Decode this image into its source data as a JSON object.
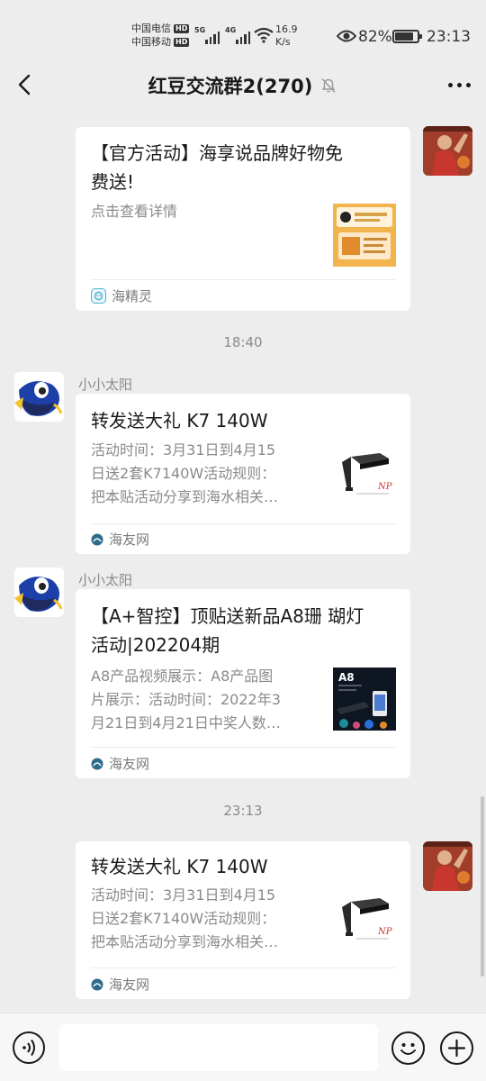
{
  "status_bar": {
    "carrier1": "中国电信",
    "carrier2": "中国移动",
    "hd_badge": "HD",
    "net1": "5G",
    "net2": "4G",
    "speed_value": "16.9",
    "speed_unit": "K/s",
    "battery_percent": "82%",
    "battery_level": 0.82,
    "time": "23:13"
  },
  "nav": {
    "title": "红豆交流群2(270)",
    "muted_icon": "bell-off-icon",
    "back_icon": "chevron-left-icon",
    "more_icon": "more-dots-icon"
  },
  "messages": [
    {
      "type": "link_card",
      "direction": "outgoing",
      "title_line1": "【官方活动】海享说品牌好物免",
      "title_line2": "费送!",
      "desc_line1": "点击查看详情",
      "source": "海精灵",
      "source_icon": "mini-program-icon"
    },
    {
      "type": "time",
      "text": "18:40"
    },
    {
      "type": "link_card",
      "direction": "incoming",
      "sender": "小小太阳",
      "title_line1": "转发送大礼 K7 140W",
      "desc_line1": "活动时间：3月31日到4月15",
      "desc_line2": "日送2套K7140W活动规则：",
      "desc_line3": "把本贴活动分享到海水相关…",
      "source": "海友网",
      "source_icon": "site-icon"
    },
    {
      "type": "link_card",
      "direction": "incoming",
      "sender": "小小太阳",
      "title_line1": "【A+智控】顶贴送新品A8珊 瑚灯",
      "title_line2": "活动|202204期",
      "desc_line1": "A8产品视频展示：A8产品图",
      "desc_line2": "片展示：活动时间：2022年3",
      "desc_line3": "月21日到4月21日中奖人数…",
      "thumb_label": "A8",
      "source": "海友网",
      "source_icon": "site-icon"
    },
    {
      "type": "time",
      "text": "23:13"
    },
    {
      "type": "link_card",
      "direction": "outgoing",
      "title_line1": "转发送大礼 K7 140W",
      "desc_line1": "活动时间：3月31日到4月15",
      "desc_line2": "日送2套K7140W活动规则：",
      "desc_line3": "把本贴活动分享到海水相关…",
      "source": "海友网",
      "source_icon": "site-icon"
    }
  ],
  "thumb_brand": "NP",
  "input_bar": {
    "voice_icon": "voice-icon",
    "emoji_icon": "emoji-icon",
    "plus_icon": "plus-icon",
    "text_value": ""
  },
  "colors": {
    "background": "#ededed",
    "card": "#ffffff",
    "text_primary": "#191919",
    "text_secondary": "#8a8a8a"
  }
}
